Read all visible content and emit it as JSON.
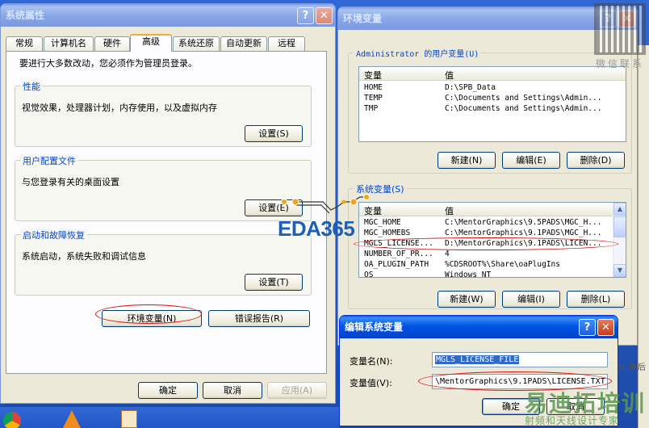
{
  "sys_props": {
    "title": "系统属性",
    "tabs": [
      "常规",
      "计算机名",
      "硬件",
      "高级",
      "系统还原",
      "自动更新",
      "远程"
    ],
    "admin_note": "要进行大多数改动，您必须作为管理员登录。",
    "performance": {
      "title": "性能",
      "desc": "视觉效果，处理器计划，内存使用，以及虚拟内存",
      "button": "设置(S)"
    },
    "user_profiles": {
      "title": "用户配置文件",
      "desc": "与您登录有关的桌面设置",
      "button": "设置(E)"
    },
    "startup": {
      "title": "启动和故障恢复",
      "desc": "系统启动，系统失败和调试信息",
      "button": "设置(T)"
    },
    "env_button": "环境变量(N)",
    "error_button": "错误报告(R)",
    "ok": "确定",
    "cancel": "取消",
    "apply": "应用(A)"
  },
  "env_vars": {
    "title": "环境变量",
    "user_group": "Administrator 的用户变量(U)",
    "col_var": "变量",
    "col_val": "值",
    "user_rows": [
      [
        "HOME",
        "D:\\SPB_Data"
      ],
      [
        "TEMP",
        "C:\\Documents and Settings\\Admin..."
      ],
      [
        "TMP",
        "C:\\Documents and Settings\\Admin..."
      ]
    ],
    "user_new": "新建(N)",
    "user_edit": "编辑(E)",
    "user_delete": "删除(D)",
    "sys_group": "系统变量(S)",
    "sys_rows": [
      [
        "MGC_HOME",
        "C:\\MentorGraphics\\9.5PADS\\MGC_H..."
      ],
      [
        "MGC_HOMEBS",
        "C:\\MentorGraphics\\9.1PADS\\MGC_H..."
      ],
      [
        "MGLS_LICENSE...",
        "D:\\MentorGraphics\\9.1PADS\\LICEN..."
      ],
      [
        "NUMBER_OF_PR...",
        "4"
      ],
      [
        "OA_PLUGIN_PATH",
        "%CDSROOT%\\Share\\oaPlugIns"
      ],
      [
        "OS",
        "Windows_NT"
      ]
    ],
    "sys_new": "新建(W)",
    "sys_edit": "编辑(I)",
    "sys_delete": "删除(L)",
    "side_text": "30 秒后"
  },
  "edit_dialog": {
    "title": "编辑系统变量",
    "name_label": "变量名(N):",
    "name_value": "MGLS_LICENSE_FILE",
    "value_label": "变量值(V):",
    "value_value": "\\MentorGraphics\\9.1PADS\\LICENSE.TXT",
    "ok": "确定",
    "cancel": "取消"
  },
  "watermarks": {
    "eda": "EDA365",
    "brand": "易迪拓培训",
    "brand_sub": "射频和天线设计专家",
    "wechat": "微信联系"
  },
  "colors": {
    "xp_blue": "#0055e5",
    "annot_red": "#d01010",
    "eda_blue": "#1b5fb8",
    "brand_green": "#3f8f3a"
  }
}
